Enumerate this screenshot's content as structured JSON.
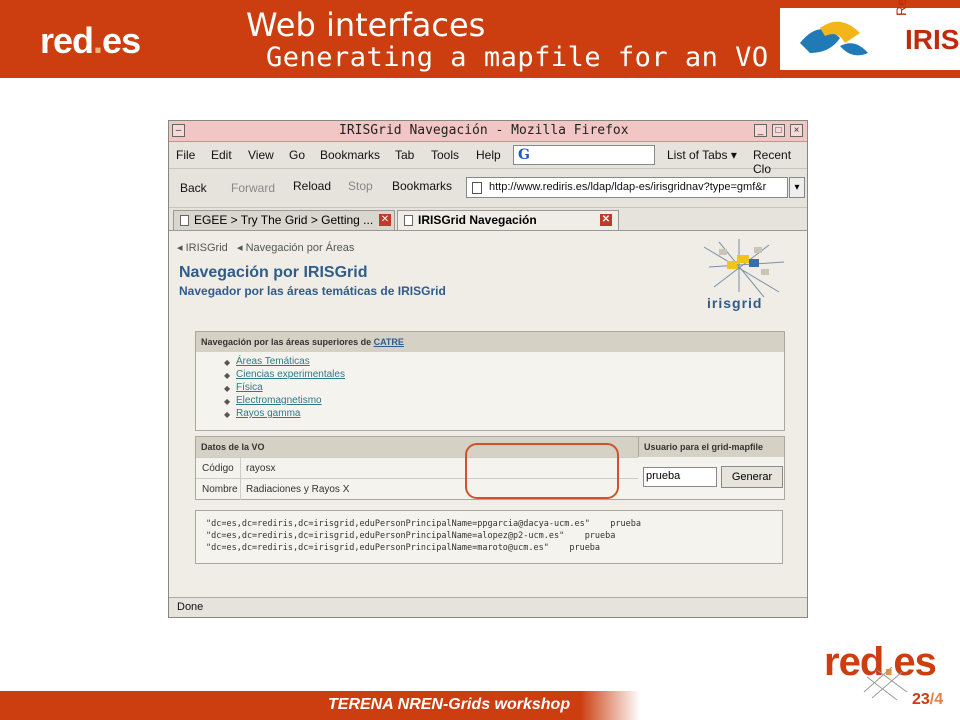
{
  "slide": {
    "logo_left": {
      "part1": "red",
      "dot": ".",
      "part2": "es"
    },
    "title": "Web interfaces",
    "subtitle": "Generating a mapfile for an VO",
    "logo_right_small": "Red",
    "logo_right_big": "IRIS",
    "watermark_main": "red",
    "watermark_dot": ".",
    "watermark_end": "es",
    "footer_text": "TERENA NREN-Grids workshop",
    "page_current": "23",
    "page_sep": "/",
    "page_total": "4",
    "bottom_logo": {
      "part1": "red",
      "dot": ".",
      "part2": "es"
    }
  },
  "browser": {
    "window_title": "IRISGrid Navegación - Mozilla Firefox",
    "menu": [
      "File",
      "Edit",
      "View",
      "Go",
      "Bookmarks",
      "Tab",
      "Tools",
      "Help"
    ],
    "search_glyph": "G",
    "list_of_tabs": "List of Tabs ▾",
    "recent_closed": "Recent Clo",
    "nav": {
      "back": "Back",
      "forward": "Forward",
      "reload": "Reload",
      "stop": "Stop",
      "bookmarks": "Bookmarks"
    },
    "url": "http://www.rediris.es/ldap/ldap-es/irisgridnav?type=gmf&r",
    "tabs": [
      {
        "label": "EGEE > Try The Grid > Getting ..."
      },
      {
        "label": "IRISGrid Navegación"
      }
    ],
    "status": "Done"
  },
  "page": {
    "crumb1": "◂ IRISGrid",
    "crumb2": "◂ Navegación por Áreas",
    "heading": "Navegación por IRISGrid",
    "subheading": "Navegador por las áreas temáticas de IRISGrid",
    "logo_text": "irisgrid",
    "areas_header_prefix": "Navegación por las áreas superiores de ",
    "areas_header_link": "CATRE",
    "areas": [
      "Áreas Temáticas",
      "Ciencias experimentales",
      "Física",
      "Electromagnetismo",
      "Rayos gamma"
    ],
    "vo_header": "Datos de la VO",
    "user_header": "Usuario para el grid-mapfile",
    "rows": [
      {
        "label": "Código",
        "value": "rayosx"
      },
      {
        "label": "Nombre",
        "value": "Radiaciones y Rayos X"
      }
    ],
    "user_value": "prueba",
    "generate_label": "Generar",
    "mapfile_lines": [
      "\"dc=es,dc=rediris,dc=irisgrid,eduPersonPrincipalName=ppgarcia@dacya-ucm.es\"    prueba",
      "\"dc=es,dc=rediris,dc=irisgrid,eduPersonPrincipalName=alopez@p2-ucm.es\"    prueba",
      "\"dc=es,dc=rediris,dc=irisgrid,eduPersonPrincipalName=maroto@ucm.es\"    prueba"
    ]
  }
}
